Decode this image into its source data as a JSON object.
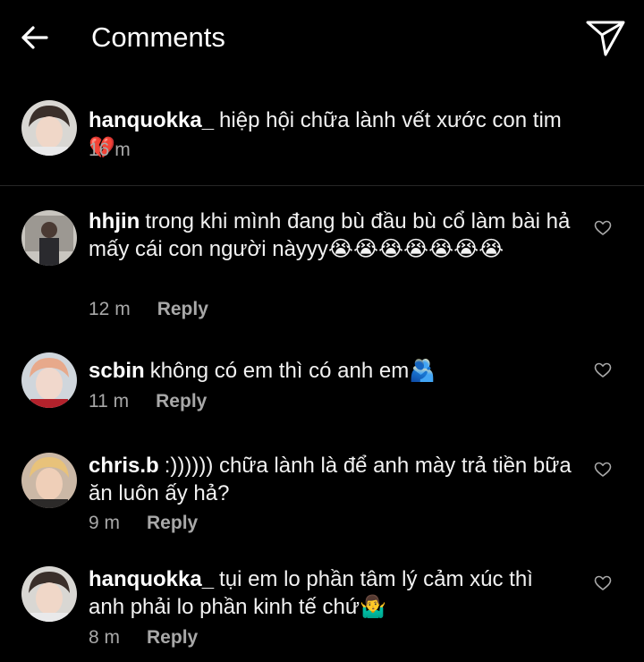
{
  "header": {
    "title": "Comments"
  },
  "caption": {
    "username": "hanquokka_",
    "text": "hiệp hội chữa lành vết xước con tim💔",
    "time": "16 m"
  },
  "comments": [
    {
      "username": "hhjin",
      "text": "trong khi mình đang bù đầu bù cổ làm bài hả mấy cái con người nàyyy😭😭😭😭😭😭😭",
      "time": "12 m",
      "reply_label": "Reply"
    },
    {
      "username": "scbin",
      "text": "không có em thì có anh em🫂",
      "time": "11 m",
      "reply_label": "Reply"
    },
    {
      "username": "chris.b",
      "text": ":)))))) chữa lành là để anh mày trả tiền bữa ăn luôn ấy hả?",
      "time": "9 m",
      "reply_label": "Reply"
    },
    {
      "username": "hanquokka_",
      "text": "tụi em lo phần tâm lý cảm xúc thì anh phải lo phần kinh tế chứ🤷‍♂️",
      "time": "8 m",
      "reply_label": "Reply"
    }
  ],
  "colors": {
    "background": "#000000",
    "text": "#ffffff",
    "secondary_text": "#a8a8a8",
    "divider": "#262626"
  },
  "icons": {
    "back": "arrow-left-icon",
    "share": "paper-plane-icon",
    "like": "heart-outline-icon"
  }
}
